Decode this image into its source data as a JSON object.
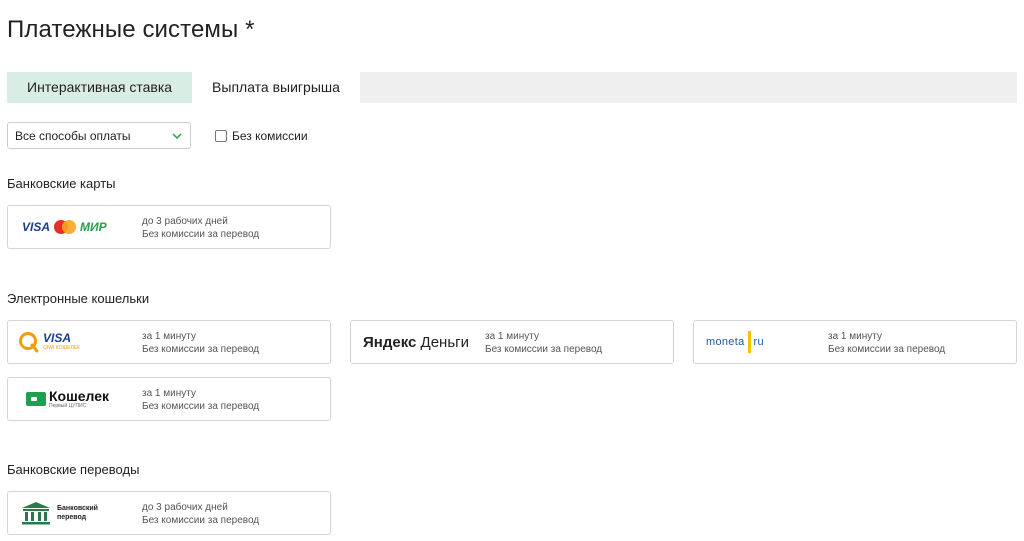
{
  "page": {
    "title": "Платежные системы *"
  },
  "tabs": [
    {
      "label": "Интерактивная ставка",
      "active": true
    },
    {
      "label": "Выплата выигрыша",
      "active": false
    }
  ],
  "filters": {
    "method_select": {
      "value": "Все способы оплаты"
    },
    "no_commission": {
      "label": "Без комиссии",
      "checked": false
    }
  },
  "sections": {
    "bank_cards": {
      "title": "Банковские карты",
      "cards": [
        {
          "logo": {
            "visa": "VISA",
            "mastercard": "mastercard",
            "mir": "МИР"
          },
          "time": "до 3 рабочих дней",
          "fee": "Без комиссии за перевод"
        }
      ]
    },
    "ewallets": {
      "title": "Электронные кошельки",
      "cards": [
        {
          "logo": {
            "visa": "VISA",
            "sub": "QIWI КОШЕЛЕК"
          },
          "time": "за 1 минуту",
          "fee": "Без комиссии за перевод"
        },
        {
          "logo": {
            "yandex": "Яндекс",
            "dengi": "Деньги"
          },
          "time": "за 1 минуту",
          "fee": "Без комиссии за перевод"
        },
        {
          "logo": {
            "moneta": "moneta",
            "ru": "ru"
          },
          "time": "за 1 минуту",
          "fee": "Без комиссии за перевод"
        },
        {
          "logo": {
            "name": "Кошелек",
            "sub": "Первый ЦУПИС"
          },
          "time": "за 1 минуту",
          "fee": "Без комиссии за перевод"
        }
      ]
    },
    "bank_transfers": {
      "title": "Банковские переводы",
      "cards": [
        {
          "logo": {
            "line1": "Банковский",
            "line2": "перевод"
          },
          "time": "до 3 рабочих дней",
          "fee": "Без комиссии за перевод"
        }
      ]
    }
  },
  "colors": {
    "active_tab": "#d8ede3",
    "tabs_bar": "#efefef",
    "card_border": "#d4d4d4",
    "qiwi_orange": "#f39c12",
    "koshelek_green": "#1e9e4e",
    "bank_green": "#2b7a4b"
  }
}
